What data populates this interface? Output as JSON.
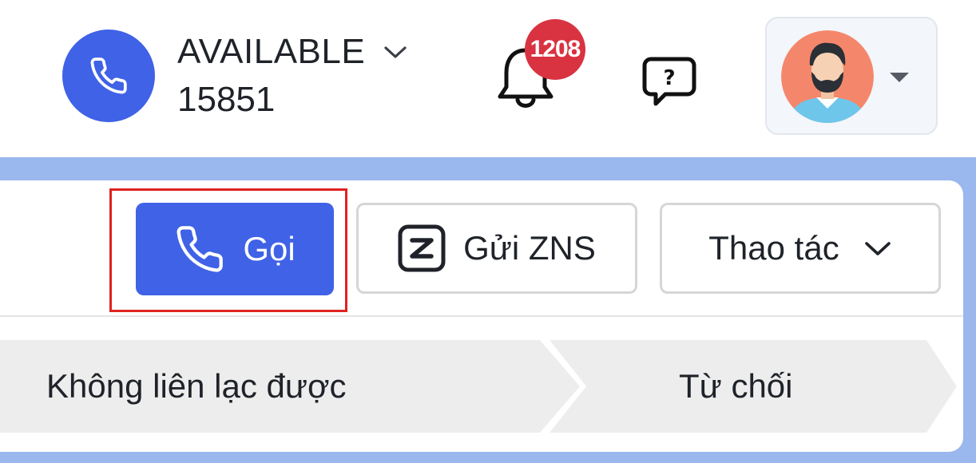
{
  "header": {
    "status": {
      "label": "AVAILABLE",
      "extension": "15851"
    },
    "notifications": {
      "count": "1208"
    },
    "icons": {
      "status": "phone-icon",
      "notifications": "bell-icon",
      "help": "help-chat-icon",
      "avatar": "user-avatar",
      "user_menu": "caret-down-icon"
    }
  },
  "toolbar": {
    "call_label": "Gọi",
    "zns_label": "Gửi ZNS",
    "actions_label": "Thao tác"
  },
  "pipeline": {
    "stages": [
      {
        "label": "Không liên lạc được"
      },
      {
        "label": "Từ chối"
      }
    ]
  },
  "colors": {
    "primary": "#3f62e6",
    "badge": "#d93240",
    "highlight": "#e02222",
    "canvas": "#9ab7ee",
    "stage_bg": "#ededed"
  }
}
